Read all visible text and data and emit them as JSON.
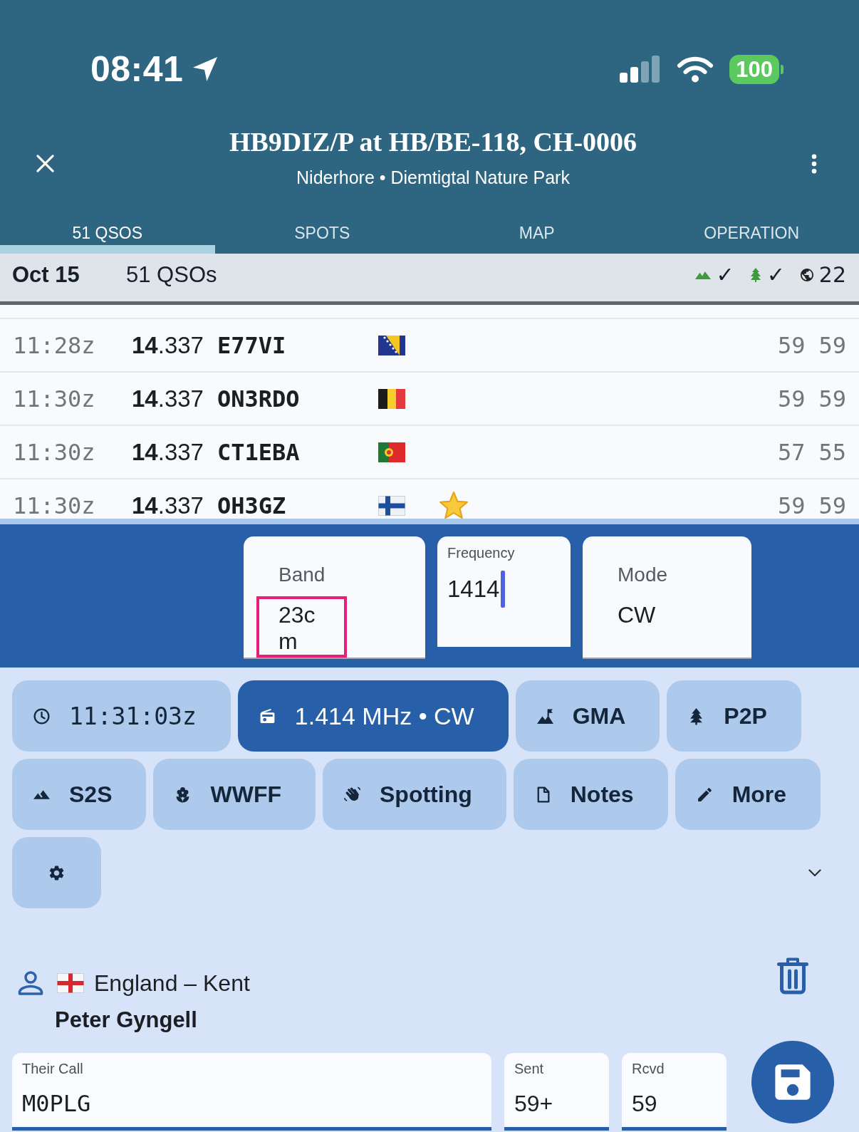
{
  "status_bar": {
    "time": "08:41",
    "battery": "100"
  },
  "header": {
    "title": "HB9DIZ/P at HB/BE-118, CH-0006",
    "subtitle": "Niderhore • Diemtigtal Nature Park"
  },
  "tabs": [
    {
      "label": "51 QSOS",
      "selected": true
    },
    {
      "label": "SPOTS",
      "selected": false
    },
    {
      "label": "MAP",
      "selected": false
    },
    {
      "label": "OPERATION",
      "selected": false
    }
  ],
  "summary": {
    "date": "Oct 15",
    "count": "51 QSOs",
    "indicators": [
      {
        "kind": "summit",
        "text": "✓"
      },
      {
        "kind": "park",
        "text": "✓"
      },
      {
        "kind": "globe",
        "text": "22"
      }
    ]
  },
  "qsos": [
    {
      "time": "11:28z",
      "frequency": "**14**.337",
      "call": "E77VI",
      "flag": {
        "kind": "bosnia"
      },
      "starred": false,
      "sent": "59",
      "rcvd": "59"
    },
    {
      "time": "11:30z",
      "frequency": "**14**.337",
      "call": "ON3RDO",
      "flag": {
        "kind": "belgium"
      },
      "starred": false,
      "sent": "59",
      "rcvd": "59"
    },
    {
      "time": "11:30z",
      "frequency": "**14**.337",
      "call": "CT1EBA",
      "flag": {
        "kind": "portugal"
      },
      "starred": false,
      "sent": "57",
      "rcvd": "55"
    },
    {
      "time": "11:30z",
      "frequency": "**14**.337",
      "call": "OH3GZ",
      "flag": {
        "kind": "finland"
      },
      "starred": true,
      "sent": "59",
      "rcvd": "59"
    }
  ],
  "band_bar": {
    "fields": [
      {
        "label": "Band",
        "value": "23cm",
        "highlighted": true,
        "focused": false
      },
      {
        "label": "Frequency",
        "value": "1414",
        "highlighted": false,
        "focused": true
      },
      {
        "label": "Mode",
        "value": "CW",
        "highlighted": false,
        "focused": false
      }
    ]
  },
  "actions": [
    {
      "kind": "time",
      "label": "11:31:03z",
      "selected": false
    },
    {
      "kind": "frequency",
      "label": "1.414 MHz • CW",
      "selected": true
    },
    {
      "kind": "summit",
      "label": "GMA",
      "selected": false
    },
    {
      "kind": "park",
      "label": "P2P",
      "selected": false
    },
    {
      "kind": "s2s",
      "label": "S2S",
      "selected": false
    },
    {
      "kind": "wwff",
      "label": "WWFF",
      "selected": false
    },
    {
      "kind": "spotting",
      "label": "Spotting",
      "selected": false
    },
    {
      "kind": "notes",
      "label": "Notes",
      "selected": false
    },
    {
      "kind": "more",
      "label": "More",
      "selected": false
    },
    {
      "kind": "settings",
      "selected": false
    }
  ],
  "contact": {
    "flag": {
      "kind": "england"
    },
    "location": "England – Kent",
    "name": "Peter Gyngell"
  },
  "entry": {
    "fields": [
      {
        "kind": "call",
        "label": "Their Call",
        "value": "M0PLG"
      },
      {
        "kind": "report",
        "label": "Sent",
        "value": "59+"
      },
      {
        "kind": "report",
        "label": "Rcvd",
        "value": "59"
      }
    ]
  }
}
